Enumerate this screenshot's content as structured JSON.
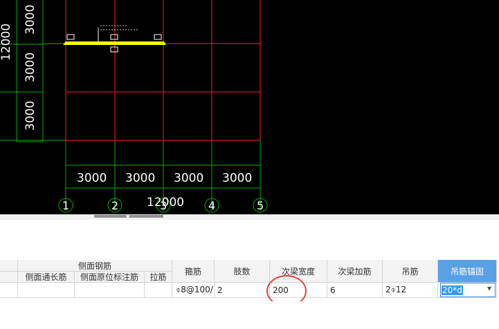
{
  "cad": {
    "dim_top_left": [
      "3000",
      "3000",
      "3000"
    ],
    "dim_total_vertical": "12000",
    "dim_bottom": [
      "3000",
      "3000",
      "3000",
      "3000"
    ],
    "dim_total_horizontal": "12000",
    "axis_labels": [
      "1",
      "2",
      "3",
      "4",
      "5"
    ],
    "colors": {
      "background": "#000000",
      "beam": "#ff2020",
      "dimension": "#00c000",
      "selected_beam": "#ffff00"
    }
  },
  "table": {
    "group_header": "侧面钢筋",
    "sub_headers": [
      "侧面通长筋",
      "侧面原位标注筋",
      "拉筋"
    ],
    "headers": [
      "箍筋",
      "肢数",
      "次梁宽度",
      "次梁加筋",
      "吊筋",
      "吊筋锚固"
    ],
    "row": {
      "side_long": "",
      "side_insitu": "",
      "tie": "",
      "stirrup": "⌽8@100/",
      "legs": "2",
      "sec_beam_width": "200",
      "sec_beam_add": "6",
      "hanger": "2⌽12",
      "hanger_anchor": "20*d"
    }
  },
  "accent_colors": {
    "active_header": "#5aa0e6",
    "annotation_circle": "#e8423c"
  }
}
